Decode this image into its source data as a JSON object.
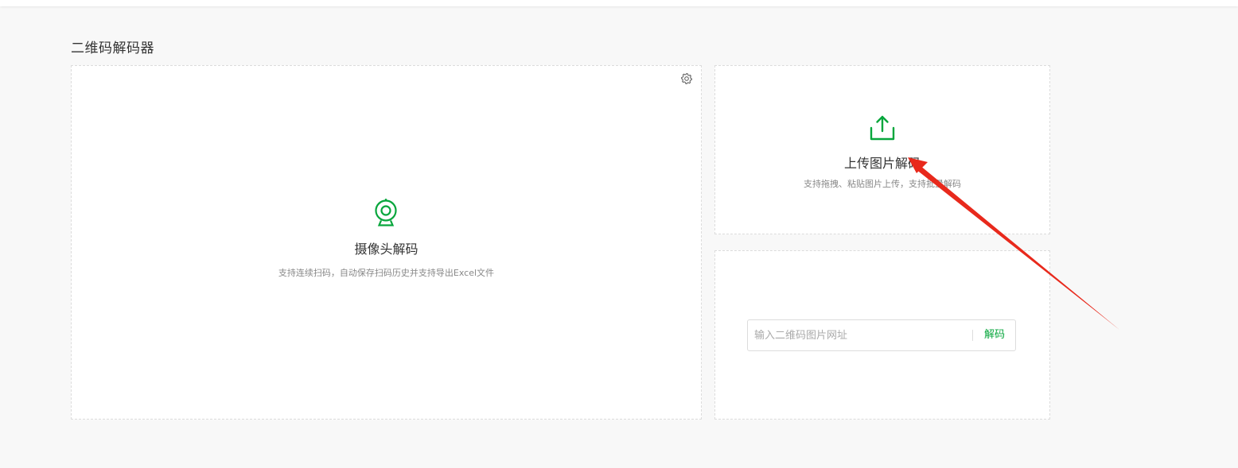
{
  "page": {
    "title": "二维码解码器"
  },
  "colors": {
    "accent": "#07a63c",
    "background": "#f8f8f8",
    "annotation": "#e8291c"
  },
  "camera_panel": {
    "icon": "webcam-icon",
    "settings_icon": "gear-icon",
    "title": "摄像头解码",
    "description": "支持连续扫码，自动保存扫码历史并支持导出Excel文件"
  },
  "upload_panel": {
    "icon": "upload-icon",
    "title": "上传图片解码",
    "description": "支持拖拽、粘贴图片上传，支持批量解码"
  },
  "url_panel": {
    "input_value": "",
    "input_placeholder": "输入二维码图片网址",
    "decode_label": "解码"
  }
}
